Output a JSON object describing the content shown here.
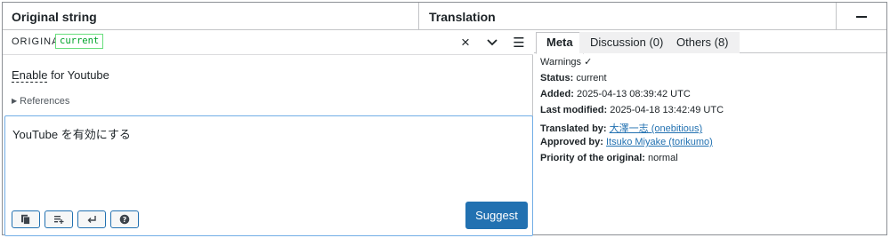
{
  "header": {
    "original_string_title": "Original string",
    "translation_title": "Translation",
    "collapse_icon": "minus-icon"
  },
  "original_bar": {
    "label": "ORIGINAL",
    "status_tag": "current",
    "icons": [
      "close-icon",
      "chevron-down-icon",
      "hamburger-menu-icon"
    ],
    "close_glyph": "×",
    "menu_glyph": "☰"
  },
  "original": {
    "glossary_word": "Enable",
    "rest_text": " for Youtube",
    "references_label": "References"
  },
  "editor": {
    "translation_value": "YouTube を有効にする",
    "suggest_label": "Suggest",
    "tool_icons": [
      "copy-original-icon",
      "insert-text-icon",
      "newline-icon",
      "help-icon"
    ]
  },
  "meta_panel": {
    "tabs": [
      {
        "label": "Meta",
        "active": true
      },
      {
        "label": "Discussion (0)",
        "active": false
      },
      {
        "label": "Others (8)",
        "active": false
      }
    ],
    "warnings": "Warnings ✓",
    "status_label": "Status:",
    "status_value": "current",
    "added_label": "Added:",
    "added_value": "2025-04-13 08:39:42 UTC",
    "last_modified_label": "Last modified:",
    "last_modified_value": "2025-04-18 13:42:49 UTC",
    "translated_by_label": "Translated by:",
    "translated_by_value": "大澤一志 (onebitious)",
    "approved_by_label": "Approved by:",
    "approved_by_value": "Itsuko Miyake (torikumo)",
    "priority_label": "Priority of the original:",
    "priority_value": "normal"
  },
  "colors": {
    "accent": "#2271b1",
    "current_tag": "#00a32a",
    "border": "#c3c4c7",
    "focus_border": "#72aee6"
  }
}
